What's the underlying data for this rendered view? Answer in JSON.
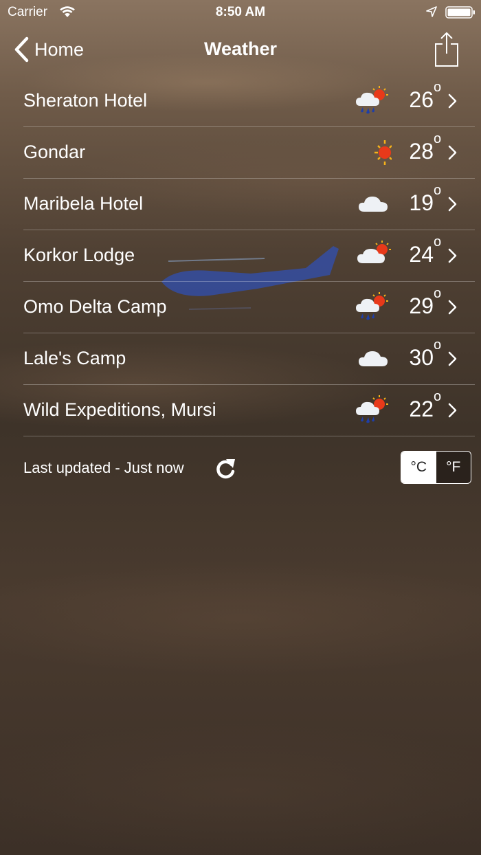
{
  "status_bar": {
    "carrier": "Carrier",
    "time": "8:50 AM"
  },
  "nav": {
    "back_label": "Home",
    "title": "Weather"
  },
  "locations": [
    {
      "name": "Sheraton Hotel",
      "temp": "26",
      "icon": "rain-sun-icon"
    },
    {
      "name": "Gondar",
      "temp": "28",
      "icon": "sun-icon"
    },
    {
      "name": "Maribela Hotel",
      "temp": "19",
      "icon": "cloud-icon"
    },
    {
      "name": "Korkor Lodge",
      "temp": "24",
      "icon": "cloud-sun-icon"
    },
    {
      "name": "Omo Delta Camp",
      "temp": "29",
      "icon": "rain-sun-icon"
    },
    {
      "name": "Lale's Camp",
      "temp": "30",
      "icon": "cloud-icon"
    },
    {
      "name": "Wild Expeditions, Mursi",
      "temp": "22",
      "icon": "rain-sun-icon"
    }
  ],
  "degree_symbol": "o",
  "footer": {
    "last_updated": "Last updated - Just now",
    "unit_celsius": "°C",
    "unit_fahrenheit": "°F",
    "selected_unit": "°C"
  },
  "colors": {
    "sun": "#e8391a",
    "rain": "#1f3fa8",
    "heli": "#2c52c8"
  }
}
